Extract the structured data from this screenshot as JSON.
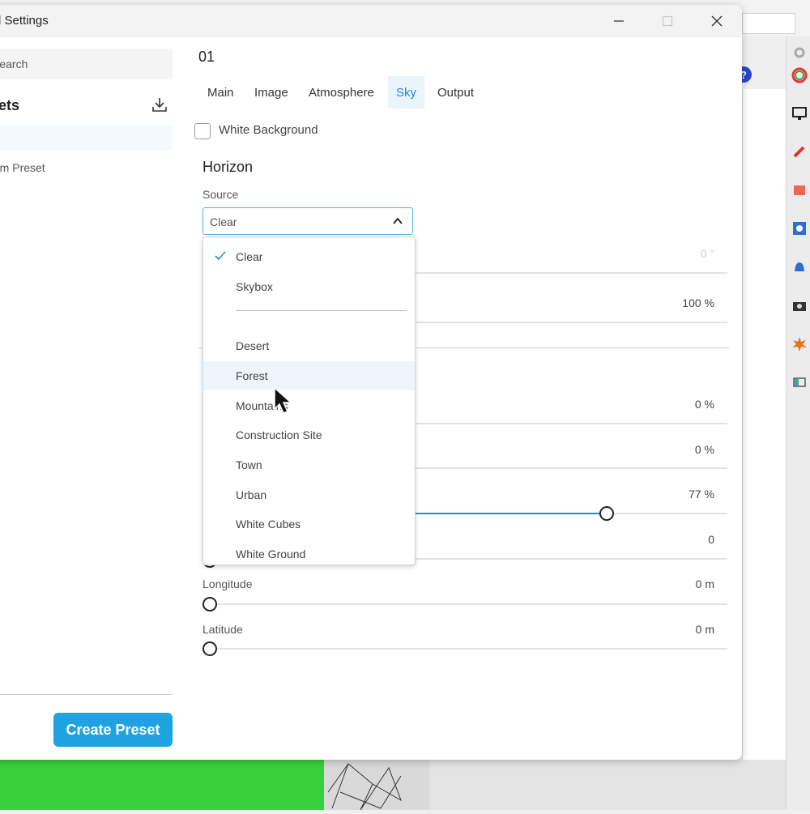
{
  "window": {
    "title": "l Settings"
  },
  "sidebar": {
    "search_placeholder": "Search",
    "presets_title": "sets",
    "custom_preset": "tom Preset",
    "create_button": "Create Preset"
  },
  "main": {
    "preset_name": "01",
    "tabs": [
      "Main",
      "Image",
      "Atmosphere",
      "Sky",
      "Output"
    ],
    "active_tab": "Sky",
    "white_background_label": "White Background",
    "horizon_title": "Horizon",
    "source_label": "Source",
    "source_value": "Clear",
    "values": {
      "rotation": "0 °",
      "opacity": "100 %",
      "v1": "0 %",
      "v2": "0 %",
      "v3": "77 %",
      "v4": "0",
      "longitude": "0 m",
      "latitude": "0 m"
    },
    "slider3_fraction": 0.77,
    "longitude_label": "Longitude",
    "latitude_label": "Latitude"
  },
  "dropdown": {
    "options_top": [
      "Clear",
      "Skybox"
    ],
    "options_bottom": [
      "Desert",
      "Forest",
      "Mountains",
      "Construction Site",
      "Town",
      "Urban",
      "White Cubes",
      "White Ground"
    ],
    "selected": "Clear",
    "hovered": "Forest"
  },
  "colors": {
    "accent": "#1fa3e0",
    "tab_active": "#1a8bd0",
    "slider_fill": "#1f8fd4",
    "background_green": "#37d23a"
  }
}
